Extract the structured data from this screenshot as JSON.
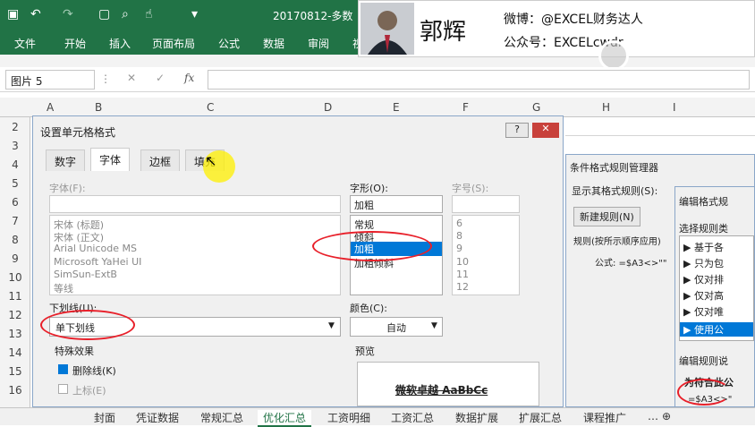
{
  "title_bar": {
    "file_name": "20170812-多数"
  },
  "ribbon": {
    "tabs": [
      "文件",
      "开始",
      "插入",
      "页面布局",
      "公式",
      "数据",
      "审阅",
      "视"
    ]
  },
  "formula_bar": {
    "name_box": "图片 5",
    "fx": "fx"
  },
  "columns": [
    "A",
    "B",
    "C",
    "D",
    "E",
    "F",
    "G",
    "H",
    "I"
  ],
  "rows": [
    "2",
    "3",
    "4",
    "5",
    "6",
    "7",
    "8",
    "9",
    "10",
    "11",
    "12",
    "13",
    "14",
    "15",
    "16"
  ],
  "banner": {
    "name": "郭辉",
    "weibo": "微博：@EXCEL财务达人",
    "wechat": "公众号：EXCELcwdr"
  },
  "format_dialog": {
    "title": "设置单元格格式",
    "help": "?",
    "tabs": [
      "数字",
      "字体",
      "边框",
      "填充"
    ],
    "font_label": "字体(F):",
    "font_list": [
      "宋体 (标题)",
      "宋体 (正文)",
      "Arial Unicode MS",
      "Microsoft YaHei UI",
      "SimSun-ExtB",
      "等线"
    ],
    "style_label": "字形(O):",
    "style_value": "加粗",
    "style_list": [
      "常规",
      "倾斜",
      "加粗",
      "加粗倾斜"
    ],
    "size_label": "字号(S):",
    "size_list": [
      "6",
      "8",
      "9",
      "10",
      "11",
      "12"
    ],
    "underline_label": "下划线(U):",
    "underline_value": "单下划线",
    "color_label": "颜色(C):",
    "color_value": "自动",
    "effects_label": "特殊效果",
    "strikethrough": "删除线(K)",
    "superscript": "上标(E)",
    "preview_label": "预览",
    "preview_text": "微软卓越  AaBbCc"
  },
  "cf_manager": {
    "title": "条件格式规则管理器",
    "show_rules_label": "显示其格式规则(S):",
    "new_rule": "新建规则(N)",
    "rule_header": "规则(按所示顺序应用)",
    "formula": "公式: =$A3<>\"\""
  },
  "edit_rule": {
    "title": "编辑格式规",
    "select_type": "选择规则类",
    "types": [
      "▶ 基于各",
      "▶ 只为包",
      "▶ 仅对排",
      "▶ 仅对高",
      "▶ 仅对唯",
      "▶ 使用公"
    ],
    "edit_desc": "编辑规则说",
    "formula_label": "为符合此公",
    "formula_value": "=$A3<>\""
  },
  "sheet_tabs": [
    "封面",
    "凭证数据",
    "常规汇总",
    "优化汇总",
    "工资明细",
    "工资汇总",
    "数据扩展",
    "扩展汇总",
    "课程推广"
  ],
  "colors": {
    "excel_green": "#217346",
    "highlight": "#0078d7",
    "annotation_red": "#e8202a"
  }
}
